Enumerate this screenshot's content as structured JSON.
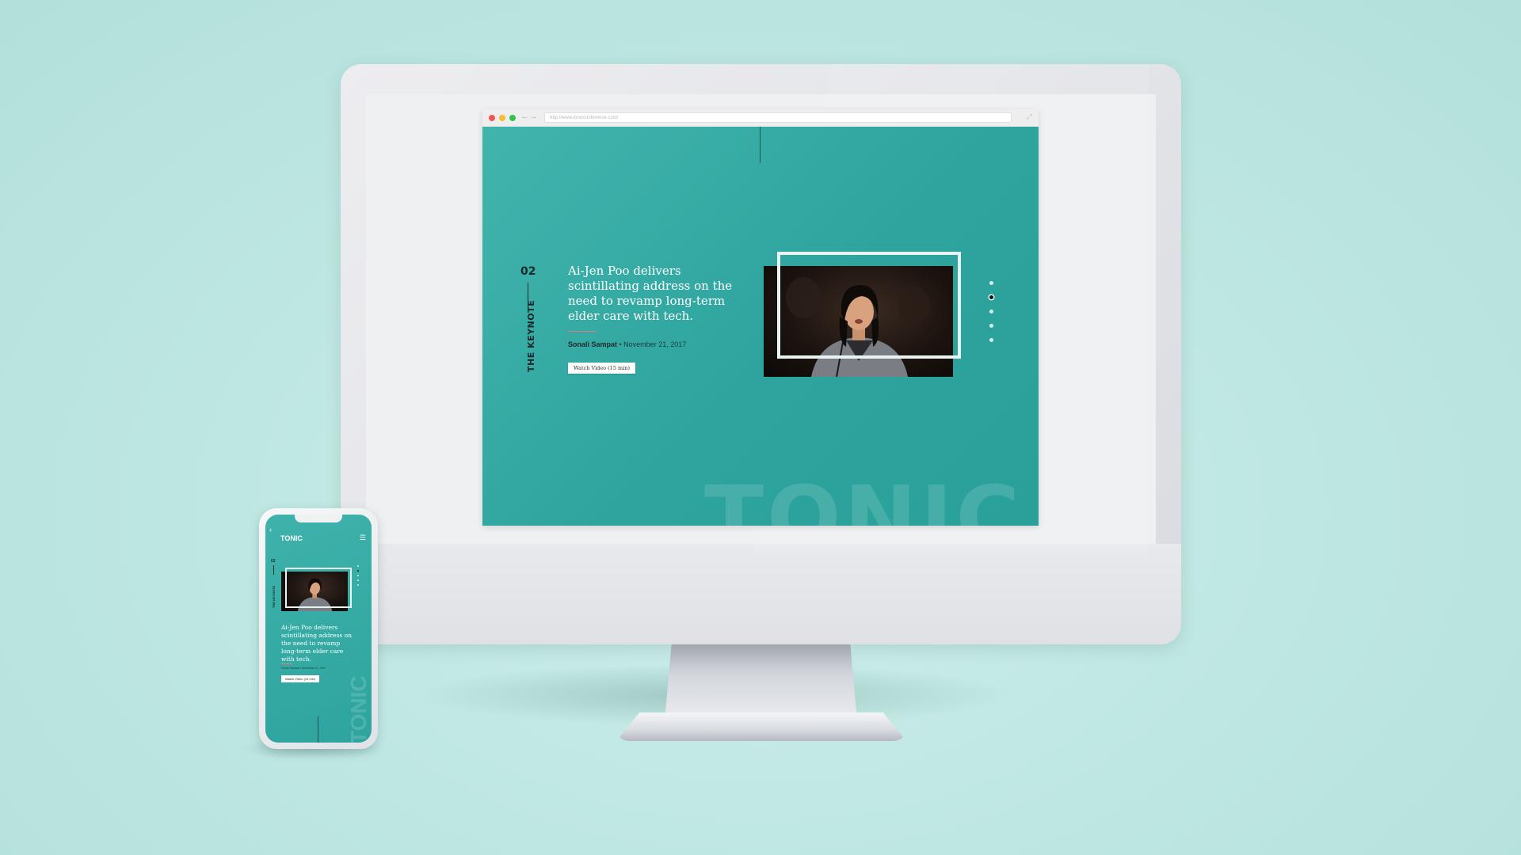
{
  "browser": {
    "url": "http://www.tonicconference.com/"
  },
  "keynote": {
    "number": "02",
    "section_label": "THE KEYNOTE",
    "headline": "Ai-Jen Poo delivers scintillating address on the need to revamp long-term elder care with tech.",
    "author": "Sonali Sampat",
    "byline_separator": " • ",
    "date": "November 21, 2017",
    "button_label": "Watch Video (15 min)",
    "slide_count": 5,
    "active_slide": 2,
    "watermark": "TONIC"
  },
  "mobile": {
    "logo": "TONIC",
    "number": "02",
    "section_label": "THE KEYNOTE",
    "headline": "Ai-Jen Poo delivers scintillating address on the need to revamp long-term elder care with tech.",
    "byline": "Sonali Sampat • November 21, 2017",
    "button_label": "Watch Video (15 min)",
    "watermark": "TONIC"
  },
  "colors": {
    "background": "#bde6e1",
    "page_teal": "#2ea49e",
    "accent": "#e07b73"
  }
}
